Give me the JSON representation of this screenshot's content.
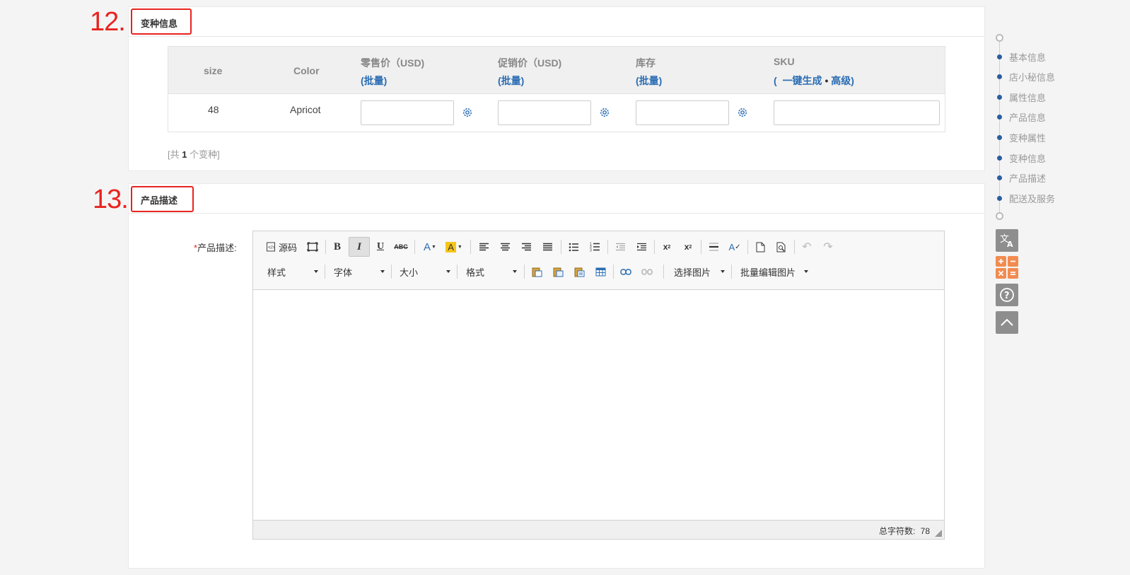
{
  "annotations": {
    "step12": "12.",
    "step13": "13."
  },
  "variant_section": {
    "title": "变种信息",
    "columns": {
      "size": "size",
      "color": "Color",
      "retail": "零售价（USD)",
      "promo": "促销价（USD)",
      "stock": "库存",
      "sku": "SKU"
    },
    "batch": "(批量)",
    "sku_actions": {
      "open": "(",
      "generate": "一键生成",
      "dot": "•",
      "advanced": "高级",
      "close": ")"
    },
    "rows": [
      {
        "size": "48",
        "color": "Apricot"
      }
    ],
    "count": {
      "prefix": "[共",
      "number": "1",
      "suffix": "个变种]"
    }
  },
  "description_section": {
    "title": "产品描述",
    "label_star": "*",
    "label": "产品描述:",
    "toolbar": {
      "source": "源码",
      "combos": {
        "style": "样式",
        "font": "字体",
        "size": "大小",
        "format": "格式",
        "select_image": "选择图片",
        "batch_edit_image": "批量编辑图片"
      }
    },
    "status": {
      "label": "总字符数:",
      "value": "78"
    }
  },
  "side_nav": {
    "items": [
      "基本信息",
      "店小秘信息",
      "属性信息",
      "产品信息",
      "变种属性",
      "变种信息",
      "产品描述",
      "配送及服务"
    ]
  },
  "colors": {
    "accent": "#2a5d9f",
    "annotation": "#e8231f",
    "link": "#2b6db3"
  }
}
